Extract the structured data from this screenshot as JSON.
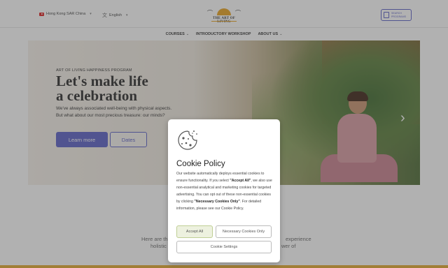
{
  "header": {
    "region_label": "Hong Kong SAR China",
    "language_label": "English",
    "logo_text": "THE ART OF LIVING",
    "search_button": {
      "line1": "SEARCH",
      "line2": "PROGRAMS"
    }
  },
  "nav": {
    "items": [
      {
        "label": "COURSES",
        "has_dropdown": true
      },
      {
        "label": "INTRODUCTORY WORKSHOP",
        "has_dropdown": false
      },
      {
        "label": "ABOUT US",
        "has_dropdown": true
      }
    ]
  },
  "hero": {
    "eyebrow": "ART OF LIVING HAPPINESS PROGRAM",
    "title_line1": "Let's make life",
    "title_line2": "a celebration",
    "subtitle": "We've always associated well-being with physical aspects. But what about our most precious treasure: our minds?",
    "learn_more_label": "Learn more",
    "dates_label": "Dates"
  },
  "below_hero": {
    "left_line1": "Here are th",
    "left_line2": "holistic",
    "right_line1": "experience",
    "right_line2": "wer of"
  },
  "cookie_modal": {
    "title": "Cookie Policy",
    "body_part1": "Our website automatically deploys essential cookies to ensure functionality. If you select ",
    "body_accept_bold": "\"Accept All\"",
    "body_part2": ", we also use non-essential analytical and marketing cookies for targeted advertising. You can opt out of these non-essential cookies by clicking ",
    "body_necessary_bold": "\"Necessary Cookies Only\"",
    "body_part3": ". For detailed information, please see our Cookie Policy.",
    "accept_all_label": "Accept All",
    "necessary_only_label": "Necessary Cookies Only",
    "settings_label": "Cookie Settings"
  },
  "colors": {
    "accent": "#5b5fc7",
    "gold": "#e3a82b",
    "accept_bg": "#edf1df"
  }
}
